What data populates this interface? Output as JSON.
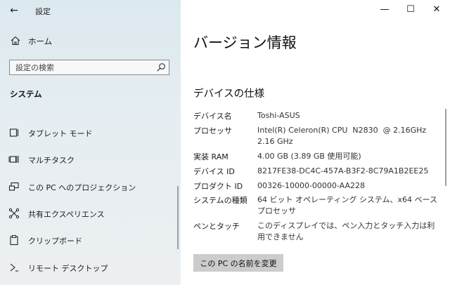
{
  "sidebar": {
    "app_title": "設定",
    "home_label": "ホーム",
    "search_placeholder": "設定の検索",
    "section_title": "システム",
    "items": [
      {
        "label": "タブレット モード"
      },
      {
        "label": "マルチタスク"
      },
      {
        "label": "この PC へのプロジェクション"
      },
      {
        "label": "共有エクスペリエンス"
      },
      {
        "label": "クリップボード"
      },
      {
        "label": "リモート デスクトップ"
      }
    ]
  },
  "main": {
    "page_title": "バージョン情報",
    "section_title": "デバイスの仕様",
    "specs": [
      {
        "key": "デバイス名",
        "value": "Toshi-ASUS"
      },
      {
        "key": "プロセッサ",
        "value": "Intel(R) Celeron(R) CPU  N2830  @ 2.16GHz",
        "value2": "2.16 GHz"
      },
      {
        "key": "実装 RAM",
        "value": "4.00 GB (3.89 GB 使用可能)"
      },
      {
        "key": "デバイス ID",
        "value": "8217FE38-DC4C-457A-B3F2-8C79A1B2EE25"
      },
      {
        "key": "プロダクト ID",
        "value": "00326-10000-00000-AA228"
      },
      {
        "key": "システムの種類",
        "value": "64 ビット オペレーティング システム、x64 ベース プロセッサ"
      },
      {
        "key": "ペンとタッチ",
        "value": "このディスプレイでは、ペン入力とタッチ入力は利用できません"
      }
    ],
    "rename_button": "この PC の名前を変更"
  },
  "window": {
    "minimize_glyph": "—",
    "maximize_glyph": "☐",
    "close_glyph": "✕",
    "back_glyph": "←"
  }
}
